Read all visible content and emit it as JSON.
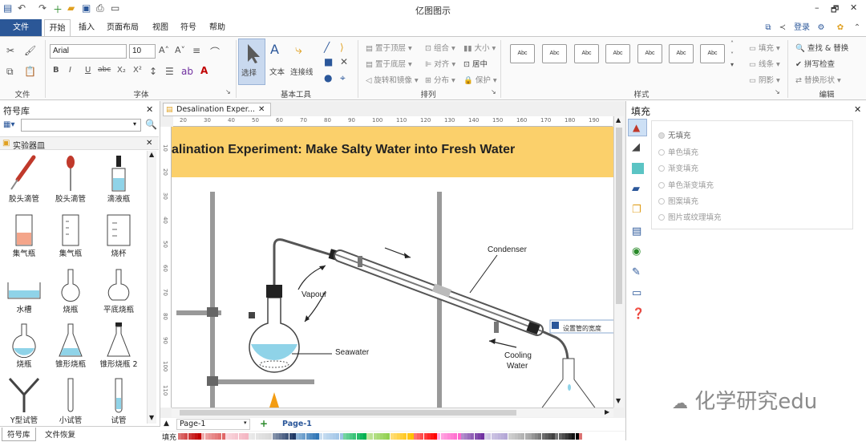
{
  "app": {
    "title": "亿图图示"
  },
  "window": {
    "minimize": "–",
    "restore": "🗗",
    "close": "✕"
  },
  "tabs": [
    {
      "label": "文件"
    },
    {
      "label": "开始"
    },
    {
      "label": "插入"
    },
    {
      "label": "页面布局"
    },
    {
      "label": "视图"
    },
    {
      "label": "符号"
    },
    {
      "label": "帮助"
    }
  ],
  "account": {
    "login": "登录"
  },
  "ribbon": {
    "groups": {
      "file": "文件",
      "font": "字体",
      "basic_tools": "基本工具",
      "arrange": "排列",
      "style": "样式",
      "edit": "编辑"
    },
    "font_name": "Arial",
    "font_size": "10",
    "tools": {
      "select": "选择",
      "text": "文本",
      "connector": "连接线"
    },
    "arrange": {
      "bring_front": "置于顶层",
      "send_back": "置于底层",
      "rotate": "旋转和镜像",
      "group": "组合",
      "align": "对齐",
      "distribute": "分布",
      "size": "大小",
      "center": "居中",
      "protect": "保护"
    },
    "style_sample": "Abc",
    "fill": "填充",
    "line": "线条",
    "shadow": "阴影",
    "find_replace": "查找 & 替换",
    "spell_check": "拼写检查",
    "replace_shape": "替换形状"
  },
  "library": {
    "title": "符号库",
    "category": "实验器皿",
    "items": [
      {
        "label": "胶头滴管"
      },
      {
        "label": "胶头滴管"
      },
      {
        "label": "滴液瓶"
      },
      {
        "label": "集气瓶"
      },
      {
        "label": "集气瓶"
      },
      {
        "label": "烧杯"
      },
      {
        "label": "水槽"
      },
      {
        "label": "烧瓶"
      },
      {
        "label": "平底烧瓶"
      },
      {
        "label": "烧瓶"
      },
      {
        "label": "锥形烧瓶"
      },
      {
        "label": "锥形烧瓶 2"
      },
      {
        "label": "Y型试管"
      },
      {
        "label": "小试管"
      },
      {
        "label": "试管"
      }
    ],
    "bottom_tabs": {
      "symbols": "符号库",
      "file_recovery": "文件恢复"
    }
  },
  "document": {
    "tab_title": "Desalination Exper...",
    "banner": "alination Experiment: Make Salty Water into Fresh Water",
    "labels": {
      "condenser": "Condenser",
      "vapour": "Vapour",
      "seawater": "Seawater",
      "cooling1": "Cooling",
      "cooling2": "Water"
    },
    "tooltip": "设置管的宽度",
    "ruler_h": [
      "20",
      "30",
      "40",
      "50",
      "60",
      "70",
      "80",
      "90",
      "100",
      "110",
      "120",
      "130",
      "140",
      "150",
      "160",
      "170",
      "180",
      "190"
    ],
    "ruler_v": [
      "10",
      "20",
      "30",
      "40",
      "50",
      "60",
      "70",
      "80",
      "90",
      "100",
      "110"
    ]
  },
  "pages": {
    "selector": "Page-1",
    "add": "+",
    "active": "Page-1",
    "fill_label": "填充"
  },
  "fill_panel": {
    "title": "填充",
    "options": [
      "无填充",
      "单色填充",
      "渐变填充",
      "单色渐变填充",
      "图案填充",
      "图片或纹理填充"
    ]
  },
  "watermark": "化学研究edu",
  "palette": [
    "#c00000",
    "#e06666",
    "#f4b6c2",
    "#d9d9d9",
    "#1f3864",
    "#2e75b6",
    "#9dc3e6",
    "#00b050",
    "#92d050",
    "#ffc000",
    "#ff0000",
    "#ff66cc",
    "#7030a0",
    "#b4a7d6",
    "#a6a6a6",
    "#404040",
    "#000000"
  ]
}
